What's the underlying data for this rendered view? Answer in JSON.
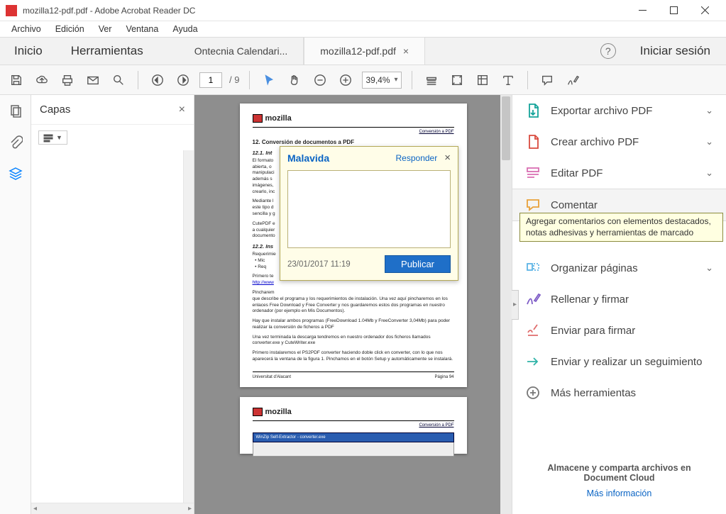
{
  "window": {
    "title": "mozilla12-pdf.pdf - Adobe Acrobat Reader DC"
  },
  "menubar": [
    "Archivo",
    "Edición",
    "Ver",
    "Ventana",
    "Ayuda"
  ],
  "maintabs": {
    "home": "Inicio",
    "tools": "Herramientas",
    "tab1": "Ontecnia Calendari...",
    "tab2": "mozilla12-pdf.pdf",
    "signin": "Iniciar sesión"
  },
  "toolbar": {
    "page_current": "1",
    "page_total": "/ 9",
    "zoom": "39,4%"
  },
  "leftpanel": {
    "title": "Capas"
  },
  "document": {
    "brand": "mozilla",
    "convlink": "Conversión a PDF",
    "h1": "12. Conversión de documentos a PDF",
    "s1": "12.1. Int",
    "p1": "El formato",
    "p1b": "abierta, o",
    "p1c": "manipulaci",
    "p1d": "además s",
    "p1e": "imágenes,",
    "p1f": "crearlo, inc",
    "p2a": "Mediante l",
    "p2b": "este tipo d",
    "p2c": "sencilla y g",
    "p3a": "CutePDF e",
    "p3b": "a cualquier",
    "p3c": "documento",
    "s2": "12.2. Ins",
    "p4": "Requerimie",
    "p4a": "• Mic",
    "p4b": "• Req",
    "p5a": "Primero te",
    "p5b": "http://www",
    "p6": "Pincharem",
    "p6b": "que describe el programa y los requerimientos de instalación. Una vez aquí pincharemos en los enlaces Free Download y Free Converter y nos guardaremos estos dos programas en nuestro ordenador (por ejemplo en Mis Documentos).",
    "p7": "Hay que instalar ambos programas (FreeDownload 1.04Mb y FreeConverter 3,04Mb) para poder realizar la conversión de ficheros a PDF",
    "p8": "Una vez terminada la descarga tendremos en nuestro ordenador dos ficheros llamados converter.exe y CuteWriter.exe",
    "p9": "Primero instalaremos el PS2PDF converter haciendo doble click en converter, con lo que nos aparecerá la ventana de la figura 1. Pinchamos en el botón Setup y automáticamente se instalará.",
    "footer_left": "Universitat d'Alacant",
    "footer_right": "Página 94"
  },
  "comment": {
    "author": "Malavida",
    "reply": "Responder",
    "date": "23/01/2017  11:19",
    "publish": "Publicar"
  },
  "rightpanel": {
    "items": [
      "Exportar archivo PDF",
      "Crear archivo PDF",
      "Editar PDF",
      "Comentar",
      "",
      "Organizar páginas",
      "Rellenar y firmar",
      "Enviar para firmar",
      "Enviar y realizar un seguimiento",
      "Más herramientas"
    ],
    "tooltip": "Agregar comentarios con elementos destacados, notas adhesivas y herramientas de marcado",
    "promo_title": "Almacene y comparta archivos en Document Cloud",
    "promo_link": "Más información"
  }
}
